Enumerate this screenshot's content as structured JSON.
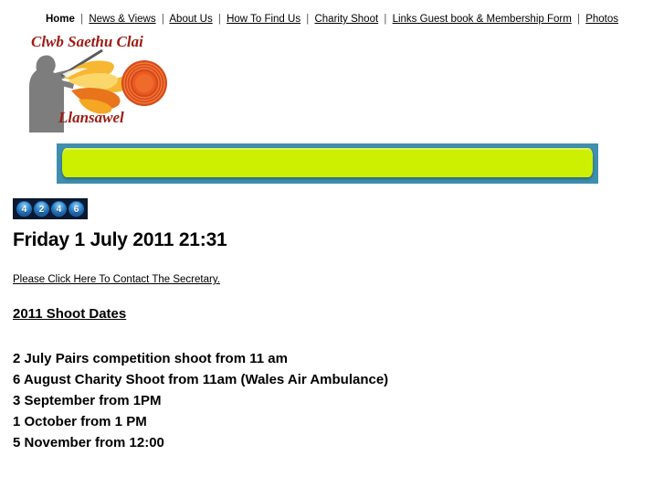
{
  "nav": {
    "separator": "|",
    "items": [
      {
        "label": "Home",
        "active": true
      },
      {
        "label": "News & Views",
        "active": false
      },
      {
        "label": "About Us",
        "active": false
      },
      {
        "label": "How To Find Us",
        "active": false
      },
      {
        "label": "Charity Shoot",
        "active": false
      },
      {
        "label": "Links Guest book & Membership Form",
        "active": false
      },
      {
        "label": "Photos",
        "active": false
      }
    ]
  },
  "logo": {
    "title": "Clwb Saethu Clai",
    "subtitle": "Llansawel",
    "title_color": "#9e1b14",
    "flame_color": "#f5a623",
    "target_color": "#e8541c",
    "silhouette_color": "#7d7d7d"
  },
  "banner": {
    "background_color": "#3f8fad",
    "bar_color": "#ccf000",
    "text": ""
  },
  "counter": {
    "digits": [
      "4",
      "2",
      "4",
      "6"
    ],
    "value": "4246",
    "background_color": "#0a1a33",
    "digit_color": "#3a8fd0"
  },
  "main": {
    "date_heading": "Friday 1 July 2011 21:31",
    "contact_link": "Please Click Here To Contact The Secretary.",
    "section_heading": "2011 Shoot Dates",
    "shoot_dates": [
      "2 July Pairs competition shoot from 11 am",
      "6 August Charity Shoot from 11am (Wales Air Ambulance)",
      "3 September from 1PM",
      "1 October from 1 PM",
      "5 November from 12:00"
    ]
  }
}
